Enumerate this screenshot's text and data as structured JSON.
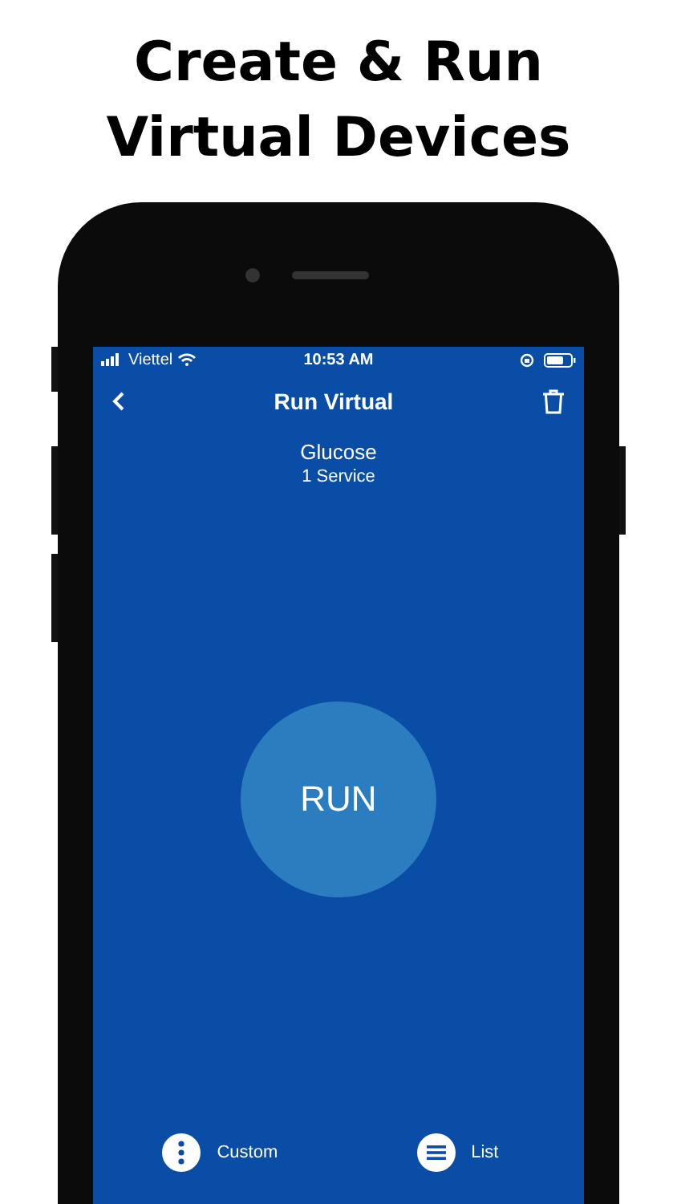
{
  "headline": [
    "Create & Run",
    "Virtual Devices"
  ],
  "status_bar": {
    "carrier": "Viettel",
    "time": "10:53 AM"
  },
  "nav": {
    "title": "Run Virtual"
  },
  "device": {
    "name": "Glucose",
    "services": "1 Service"
  },
  "run_button": {
    "label": "RUN"
  },
  "bottom_actions": [
    {
      "kind": "custom",
      "label": "Custom"
    },
    {
      "kind": "list",
      "label": "List"
    }
  ]
}
